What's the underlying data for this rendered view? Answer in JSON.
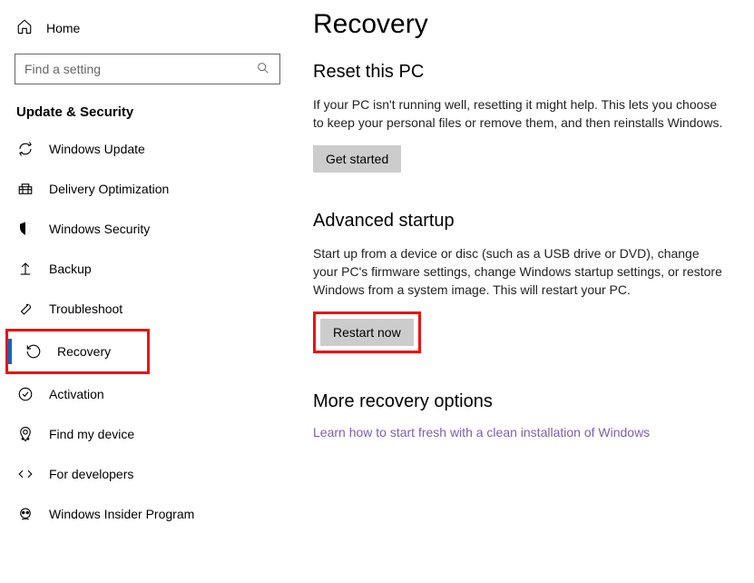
{
  "sidebar": {
    "home": "Home",
    "search_placeholder": "Find a setting",
    "section": "Update & Security",
    "items": [
      {
        "id": "windows-update",
        "label": "Windows Update"
      },
      {
        "id": "delivery-optimization",
        "label": "Delivery Optimization"
      },
      {
        "id": "windows-security",
        "label": "Windows Security"
      },
      {
        "id": "backup",
        "label": "Backup"
      },
      {
        "id": "troubleshoot",
        "label": "Troubleshoot"
      },
      {
        "id": "recovery",
        "label": "Recovery"
      },
      {
        "id": "activation",
        "label": "Activation"
      },
      {
        "id": "find-my-device",
        "label": "Find my device"
      },
      {
        "id": "for-developers",
        "label": "For developers"
      },
      {
        "id": "windows-insider",
        "label": "Windows Insider Program"
      }
    ]
  },
  "main": {
    "title": "Recovery",
    "reset": {
      "heading": "Reset this PC",
      "desc": "If your PC isn't running well, resetting it might help. This lets you choose to keep your personal files or remove them, and then reinstalls Windows.",
      "button": "Get started"
    },
    "advanced": {
      "heading": "Advanced startup",
      "desc": "Start up from a device or disc (such as a USB drive or DVD), change your PC's firmware settings, change Windows startup settings, or restore Windows from a system image. This will restart your PC.",
      "button": "Restart now"
    },
    "more": {
      "heading": "More recovery options",
      "link": "Learn how to start fresh with a clean installation of Windows"
    }
  }
}
